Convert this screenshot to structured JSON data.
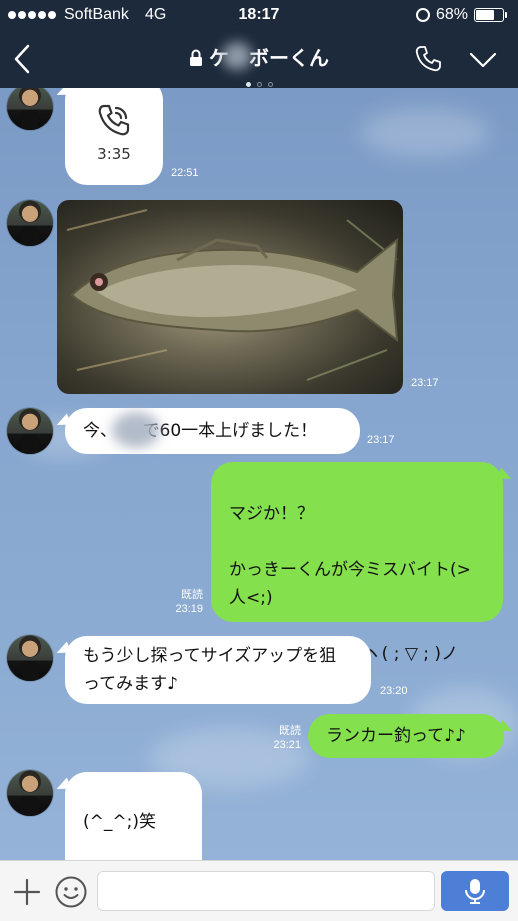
{
  "status_bar": {
    "carrier": "SoftBank",
    "network": "4G",
    "time": "18:17",
    "battery": "68%",
    "battery_level": 0.68
  },
  "header": {
    "title": "ケ　ボーくん",
    "icons": [
      "back-icon",
      "lock-icon",
      "phone-icon",
      "chevron-down-icon"
    ],
    "page_dots": 3,
    "active_page": 0
  },
  "messages": [
    {
      "side": "left",
      "type": "call",
      "text": "3:35",
      "time": "22:51"
    },
    {
      "side": "left",
      "type": "image",
      "time": "23:17"
    },
    {
      "side": "left",
      "type": "text",
      "text": "今、　　で60一本上げました！",
      "time": "23:17"
    },
    {
      "side": "right",
      "type": "text",
      "text": "マジか！？\n\nかっきーくんが今ミスバイト(>人<;)\n\nオレも更にのらずヽ( ; ▽ ; )ノ",
      "read": "既読",
      "time": "23:19"
    },
    {
      "side": "left",
      "type": "text",
      "text": "もう少し探ってサイズアップを狙ってみます♪",
      "time": "23:20"
    },
    {
      "side": "right",
      "type": "text",
      "text": "ランカー釣って♪♪",
      "read": "既読",
      "time": "23:21"
    },
    {
      "side": "left",
      "type": "text",
      "text": "(^_^;)笑\n\n頑張ります!!"
    }
  ],
  "input_bar": {
    "placeholder": "",
    "icons": [
      "plus-icon",
      "emoji-icon",
      "mic-icon"
    ]
  },
  "colors": {
    "header_bg": "#1d2a3b",
    "chat_bg": "#7e9ec8",
    "incoming_bubble": "#ffffff",
    "outgoing_bubble": "#84e04c",
    "send_button": "#4d7fd6"
  }
}
